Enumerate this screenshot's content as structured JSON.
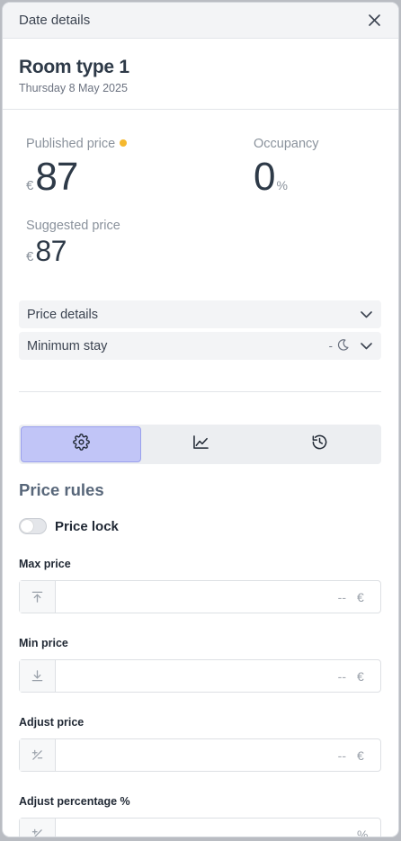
{
  "dialog": {
    "title": "Date details"
  },
  "header": {
    "room": "Room type 1",
    "date": "Thursday 8 May 2025"
  },
  "stats": {
    "published_label": "Published price",
    "published_currency": "€",
    "published_value": "87",
    "occupancy_label": "Occupancy",
    "occupancy_value": "0",
    "occupancy_unit": "%",
    "suggested_label": "Suggested price",
    "suggested_currency": "€",
    "suggested_value": "87",
    "status_dot_color": "#f5b82e"
  },
  "accordions": {
    "price_details": "Price details",
    "minimum_stay": "Minimum stay",
    "minimum_stay_value": "-"
  },
  "tabs": [
    {
      "icon": "gear-icon",
      "active": true
    },
    {
      "icon": "chart-line-icon",
      "active": false
    },
    {
      "icon": "history-icon",
      "active": false
    }
  ],
  "price_rules": {
    "title": "Price rules",
    "price_lock_label": "Price lock",
    "price_lock_on": false,
    "max_price": {
      "label": "Max price",
      "placeholder": "--",
      "suffix": "€",
      "icon": "arrow-up-to-line-icon"
    },
    "min_price": {
      "label": "Min price",
      "placeholder": "--",
      "suffix": "€",
      "icon": "arrow-down-to-line-icon"
    },
    "adjust_price": {
      "label": "Adjust price",
      "placeholder": "--",
      "suffix": "€",
      "icon": "plus-minus-icon"
    },
    "adjust_percentage": {
      "label": "Adjust percentage %",
      "placeholder": "",
      "suffix": "%",
      "icon": "plus-minus-icon"
    }
  },
  "colors": {
    "accent_tab": "#c1c5f7",
    "title": "#2e3a48"
  }
}
